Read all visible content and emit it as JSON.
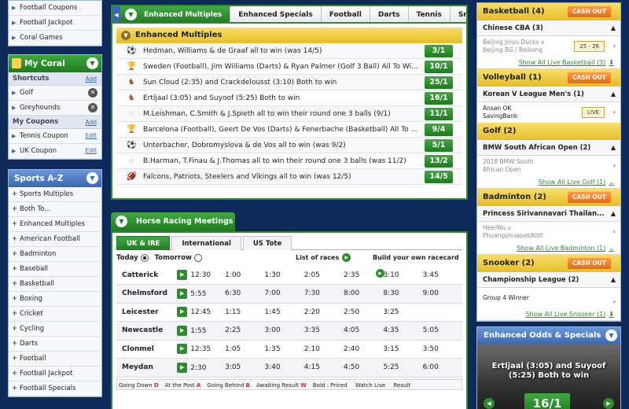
{
  "left": {
    "top_items": [
      "Football Coupons",
      "Football Jackpot",
      "Coral Games"
    ],
    "my_coral": {
      "title": "My Coral",
      "shortcuts_label": "Shortcuts",
      "add_label": "Add",
      "shortcuts": [
        "Golf",
        "Greyhounds"
      ],
      "coupons_label": "My Coupons",
      "coupons": [
        "Tennis Coupon",
        "UK Coupon"
      ],
      "edit_label": "Edit"
    },
    "sports_az": {
      "title": "Sports A-Z",
      "items": [
        "Sports Multiples",
        "Both To...",
        "Enhanced Multiples",
        "American Football",
        "Badminton",
        "Baseball",
        "Basketball",
        "Boxing",
        "Cricket",
        "Cycling",
        "Darts",
        "Football",
        "Football Jackpot",
        "Football Specials"
      ]
    }
  },
  "specials": {
    "tabs": [
      "Enhanced Multiples",
      "Enhanced Specials",
      "Football",
      "Darts",
      "Tennis",
      "Snooker"
    ],
    "header": "Enhanced Multiples",
    "rows": [
      {
        "sport": "football",
        "text": "Hedman, Williams & de Graaf all to win (was 14/5)",
        "odds": "3/1"
      },
      {
        "sport": "trophy",
        "text": "Sweden (Football), Jim Williams (Darts) & Ryan Palmer (Golf 3 Ball) All To Win (W...",
        "odds": "10/1"
      },
      {
        "sport": "horse",
        "text": "Sun Cloud (2:35) and Crackdelousst (3:10) Both to win",
        "odds": "25/1"
      },
      {
        "sport": "horse",
        "text": "Ertljaal (3:05) and Suyoof (5:25) Both to win",
        "odds": "16/1"
      },
      {
        "sport": "golf",
        "text": "M.Leishman, C.Smith & J.Spieth all to win their round one 3 balls (9/1)",
        "odds": "11/1"
      },
      {
        "sport": "trophy",
        "text": "Barcelona (Football), Geert De Vos (Darts) & Fenerbache (Basketball) All To Win (W...",
        "odds": "9/4"
      },
      {
        "sport": "football",
        "text": "Unterbacher, Dobromyslova & de Vos all to win (was 9/2)",
        "odds": "5/1"
      },
      {
        "sport": "golf",
        "text": "B.Harman, T.Finau & J.Thomas all to win their round one 3 balls (was 11/2)",
        "odds": "13/2"
      },
      {
        "sport": "nfl",
        "text": "Falcons, Patriots, Steelers and Vikings all to win (was 12/5)",
        "odds": "14/5"
      }
    ]
  },
  "racing": {
    "title": "Horse Racing Meetings",
    "tabs": [
      "UK & IRE",
      "International",
      "US Tote"
    ],
    "today": "Today",
    "tomorrow": "Tomorrow",
    "list_races": "List of races",
    "build_card": "Build your own racecard",
    "meetings": [
      {
        "course": "Catterick",
        "times": [
          "12:30",
          "1:00",
          "1:30",
          "2:05",
          "2:35",
          "3:10",
          "3:45"
        ]
      },
      {
        "course": "Chelmsford",
        "times": [
          "5:55",
          "6:30",
          "7:00",
          "7:30",
          "8:00",
          "8:30",
          "9:00"
        ]
      },
      {
        "course": "Leicester",
        "times": [
          "12:45",
          "1:15",
          "1:45",
          "2:20",
          "2:50",
          "3:25",
          ""
        ]
      },
      {
        "course": "Newcastle",
        "times": [
          "1:55",
          "2:25",
          "3:00",
          "3:35",
          "4:05",
          "4:35",
          "5:05"
        ]
      },
      {
        "course": "Clonmel",
        "times": [
          "12:35",
          "1:05",
          "1:35",
          "2:10",
          "2:40",
          "3:15",
          "3:50"
        ]
      },
      {
        "course": "Meydan",
        "times": [
          "2:30",
          "3:05",
          "3:40",
          "4:15",
          "4:50",
          "5:25",
          "6:00"
        ]
      }
    ],
    "legend": [
      {
        "label": "Going Down",
        "code": "D"
      },
      {
        "label": "At the Post",
        "code": "A"
      },
      {
        "label": "Going Behind",
        "code": "B"
      },
      {
        "label": "Awaiting Result",
        "code": "W"
      },
      {
        "label": "Bold : Priced",
        "code": ""
      },
      {
        "label": "Watch Live",
        "code": ""
      },
      {
        "label": "Result",
        "code": ""
      }
    ]
  },
  "live": {
    "cash_out": "CASH OUT",
    "basketball": {
      "title": "Basketball (4)",
      "league": "Chinese CBA (3)",
      "event": [
        "Beijing Jinyu Ducks v",
        "Beijing BG / Beikong"
      ],
      "score": "25 - 26",
      "show": "Show All Live Basketball (3)"
    },
    "volleyball": {
      "title": "Volleyball (1)",
      "league": "Korean V League Men's (1)",
      "event": [
        "Ansan OK",
        "SavingBank"
      ],
      "live": "LIVE"
    },
    "golf": {
      "title": "Golf (2)",
      "league": "BMW South African Open (2)",
      "event": [
        "2018 BMW South",
        "African Open"
      ],
      "show": "Show All Live Golf (1)"
    },
    "badminton": {
      "title": "Badminton (2)",
      "league": "Princess Sirivannavari Thailan...",
      "event": [
        "Hee/Wu v",
        "Phuangphuapet/Kitit"
      ],
      "show": "Show All Live Badminton (1)"
    },
    "snooker": {
      "title": "Snooker (2)",
      "league": "Championship League (2)",
      "event": [
        "Group 4 Winner"
      ],
      "show": "Show All Live Snooker (1)"
    }
  },
  "enhanced_odds": {
    "title": "Enhanced Odds & Specials",
    "text": "Ertljaal (3:05) and Suyoof (5:25) Both to win",
    "odds": "16/1"
  },
  "colors": {
    "green": "#2e8b2e",
    "yellow": "#e6be27",
    "blue": "#3a68b0",
    "orange": "#e86a14",
    "navy": "#0d2a5a"
  }
}
